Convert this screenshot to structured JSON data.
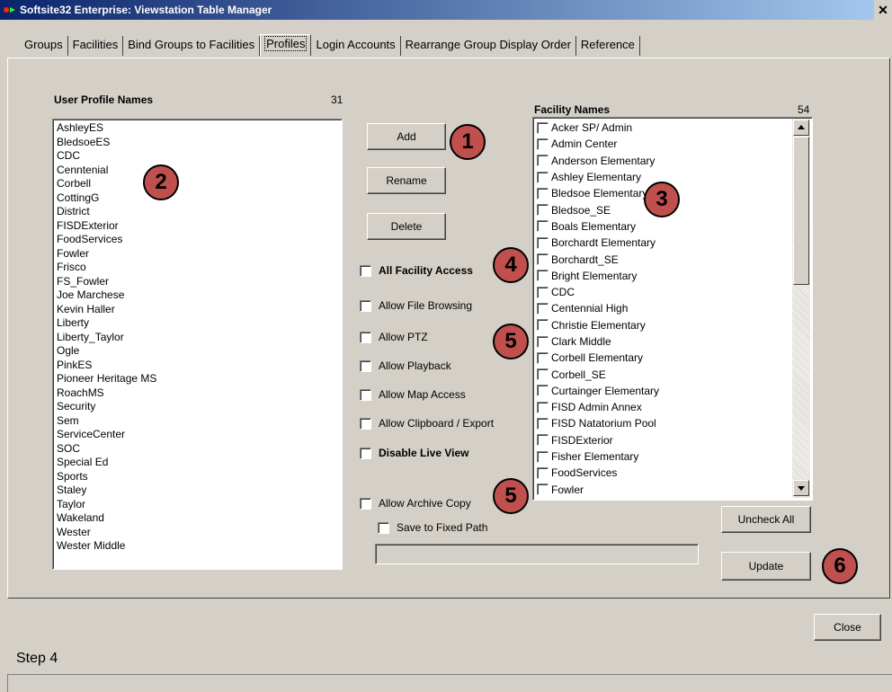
{
  "window": {
    "title": "Softsite32 Enterprise: Viewstation Table Manager",
    "close_glyph": "✕"
  },
  "tabs": [
    {
      "label": "Groups"
    },
    {
      "label": "Facilities"
    },
    {
      "label": "Bind Groups to Facilities"
    },
    {
      "label": "Profiles",
      "active": true
    },
    {
      "label": "Login Accounts"
    },
    {
      "label": "Rearrange Group Display Order"
    },
    {
      "label": "Reference"
    }
  ],
  "profiles": {
    "header": "User Profile Names",
    "count": "31",
    "items": [
      "AshleyES",
      "BledsoeES",
      "CDC",
      "Cenntenial",
      "Corbell",
      "CottingG",
      "District",
      "FISDExterior",
      "FoodServices",
      "Fowler",
      "Frisco",
      "FS_Fowler",
      "Joe Marchese",
      "Kevin Haller",
      "Liberty",
      "Liberty_Taylor",
      "Ogle",
      "PinkES",
      "Pioneer Heritage MS",
      "RoachMS",
      "Security",
      "Sem",
      "ServiceCenter",
      "SOC",
      "Special Ed",
      "Sports",
      "Staley",
      "Taylor",
      "Wakeland",
      "Wester",
      "Wester Middle"
    ]
  },
  "actions": {
    "add": "Add",
    "rename": "Rename",
    "delete": "Delete",
    "uncheck_all": "Uncheck All",
    "update": "Update",
    "close": "Close"
  },
  "permissions": {
    "all_facility_access": "All Facility Access",
    "allow_file_browsing": "Allow File Browsing",
    "allow_ptz": "Allow PTZ",
    "allow_playback": "Allow Playback",
    "allow_map_access": "Allow Map Access",
    "allow_clipboard_export": "Allow Clipboard / Export",
    "disable_live_view": "Disable Live View",
    "allow_archive_copy": "Allow Archive Copy",
    "save_to_fixed_path": "Save to Fixed Path",
    "fixed_path_value": ""
  },
  "facilities": {
    "header": "Facility Names",
    "count": "54",
    "items": [
      "Acker SP/ Admin",
      "Admin Center",
      "Anderson Elementary",
      "Ashley Elementary",
      "Bledsoe Elementary",
      "Bledsoe_SE",
      "Boals Elementary",
      "Borchardt Elementary",
      "Borchardt_SE",
      "Bright Elementary",
      "CDC",
      "Centennial High",
      "Christie Elementary",
      "Clark Middle",
      "Corbell Elementary",
      "Corbell_SE",
      "Curtainger Elementary",
      "FISD Admin Annex",
      "FISD Natatorium Pool",
      "FISDExterior",
      "Fisher Elementary",
      "FoodServices",
      "Fowler"
    ]
  },
  "callouts": {
    "c1": "1",
    "c2": "2",
    "c3": "3",
    "c4": "4",
    "c5a": "5",
    "c5b": "5",
    "c6": "6"
  },
  "footer": {
    "step": "Step 4"
  },
  "colors": {
    "callout_fill": "#c0504d",
    "window_bg": "#d4d0c8",
    "titlebar_start": "#0a246a"
  }
}
